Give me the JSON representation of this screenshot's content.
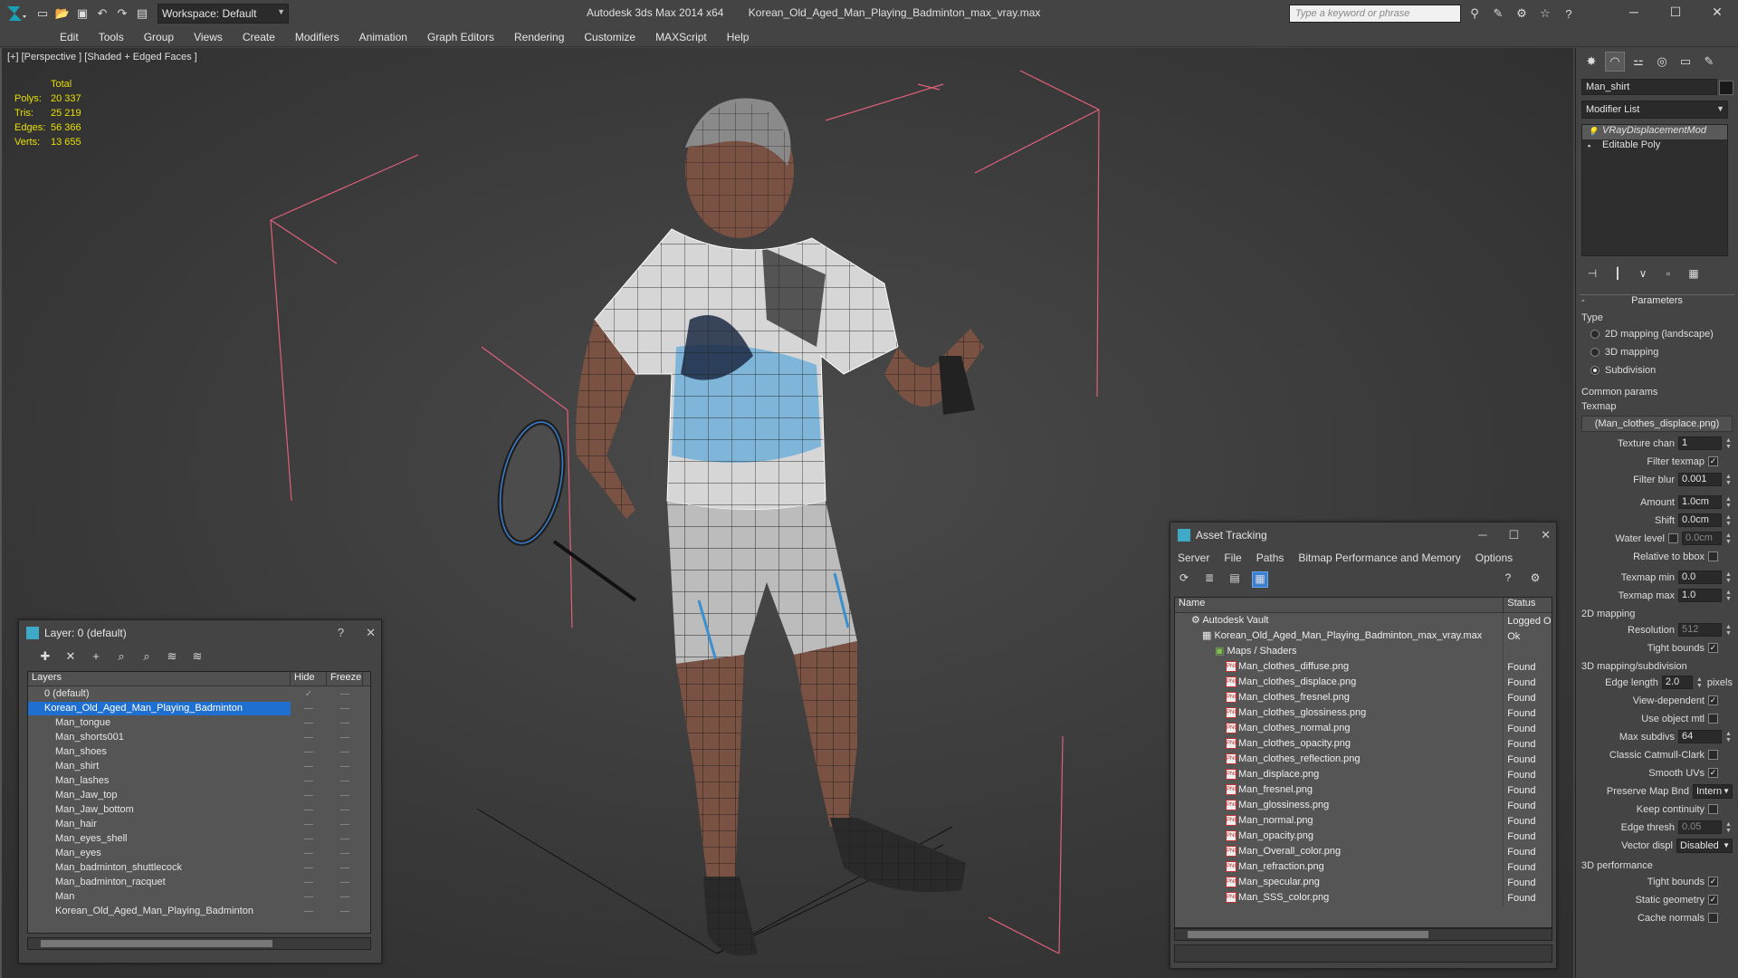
{
  "app": {
    "title": "Autodesk 3ds Max  2014 x64",
    "file": "Korean_Old_Aged_Man_Playing_Badminton_max_vray.max",
    "workspace": "Workspace: Default",
    "search_placeholder": "Type a keyword or phrase"
  },
  "menu": [
    "Edit",
    "Tools",
    "Group",
    "Views",
    "Create",
    "Modifiers",
    "Animation",
    "Graph Editors",
    "Rendering",
    "Customize",
    "MAXScript",
    "Help"
  ],
  "viewport": {
    "label": "[+] [Perspective ] [Shaded + Edged Faces ]",
    "stats_header": "Total",
    "stats": [
      {
        "k": "Polys:",
        "v": "20 337"
      },
      {
        "k": "Tris:",
        "v": "25 219"
      },
      {
        "k": "Edges:",
        "v": "56 366"
      },
      {
        "k": "Verts:",
        "v": "13 655"
      }
    ]
  },
  "command_panel": {
    "object_name": "Man_shirt",
    "modifier_list": "Modifier List",
    "stack": [
      "VRayDisplacementMod",
      "Editable Poly"
    ],
    "parameters_title": "Parameters",
    "type_label": "Type",
    "types": [
      {
        "label": "2D mapping (landscape)",
        "on": false
      },
      {
        "label": "3D mapping",
        "on": false
      },
      {
        "label": "Subdivision",
        "on": true
      }
    ],
    "common_params": "Common params",
    "texmap_label": "Texmap",
    "texmap": "(Man_clothes_displace.png)",
    "texture_chan_label": "Texture chan",
    "texture_chan": "1",
    "filter_texmap_label": "Filter texmap",
    "filter_blur_label": "Filter blur",
    "filter_blur": "0.001",
    "amount_label": "Amount",
    "amount": "1.0cm",
    "shift_label": "Shift",
    "shift": "0.0cm",
    "water_level_label": "Water level",
    "water_level": "0.0cm",
    "relative_bbox_label": "Relative to bbox",
    "texmap_min_label": "Texmap min",
    "texmap_min": "0.0",
    "texmap_max_label": "Texmap max",
    "texmap_max": "1.0",
    "mapping2d_label": "2D mapping",
    "resolution_label": "Resolution",
    "resolution": "512",
    "tight_bounds_label": "Tight bounds",
    "mapping3d_label": "3D mapping/subdivision",
    "edge_length_label": "Edge length",
    "edge_length": "2.0",
    "pixels_label": "pixels",
    "view_dependent_label": "View-dependent",
    "use_object_mtl_label": "Use object mtl",
    "max_subdivs_label": "Max subdivs",
    "max_subdivs": "64",
    "catmull_label": "Classic Catmull-Clark",
    "smooth_uvs_label": "Smooth UVs",
    "preserve_map_label": "Preserve Map Bnd",
    "preserve_map": "Intern",
    "keep_continuity_label": "Keep continuity",
    "edge_thresh_label": "Edge thresh",
    "edge_thresh": "0.05",
    "vector_displ_label": "Vector displ",
    "vector_displ": "Disabled",
    "perf_label": "3D performance",
    "perf_tight_label": "Tight bounds",
    "static_geom_label": "Static geometry",
    "cache_normals_label": "Cache normals"
  },
  "layer_window": {
    "title": "Layer: 0 (default)",
    "help": "?",
    "col_layers": "Layers",
    "col_hide": "Hide",
    "col_freeze": "Freeze",
    "rows": [
      "0 (default)",
      "Korean_Old_Aged_Man_Playing_Badminton",
      "Man_tongue",
      "Man_shorts001",
      "Man_shoes",
      "Man_shirt",
      "Man_lashes",
      "Man_Jaw_top",
      "Man_Jaw_bottom",
      "Man_hair",
      "Man_eyes_shell",
      "Man_eyes",
      "Man_badminton_shuttlecock",
      "Man_badminton_racquet",
      "Man",
      "Korean_Old_Aged_Man_Playing_Badminton"
    ]
  },
  "asset_window": {
    "title": "Asset Tracking",
    "menu": [
      "Server",
      "File",
      "Paths",
      "Bitmap Performance and Memory",
      "Options"
    ],
    "col_name": "Name",
    "col_status": "Status",
    "vault": "Autodesk Vault",
    "vault_status": "Logged O",
    "file": "Korean_Old_Aged_Man_Playing_Badminton_max_vray.max",
    "file_status": "Ok",
    "maps_group": "Maps / Shaders",
    "found": "Found",
    "maps": [
      "Man_clothes_diffuse.png",
      "Man_clothes_displace.png",
      "Man_clothes_fresnel.png",
      "Man_clothes_glossiness.png",
      "Man_clothes_normal.png",
      "Man_clothes_opacity.png",
      "Man_clothes_reflection.png",
      "Man_displace.png",
      "Man_fresnel.png",
      "Man_glossiness.png",
      "Man_normal.png",
      "Man_opacity.png",
      "Man_Overall_color.png",
      "Man_refraction.png",
      "Man_specular.png",
      "Man_SSS_color.png"
    ]
  },
  "colors": {
    "selection": "#1e6fd0",
    "stats": "#e6e000",
    "bbox": "#e0607a"
  }
}
